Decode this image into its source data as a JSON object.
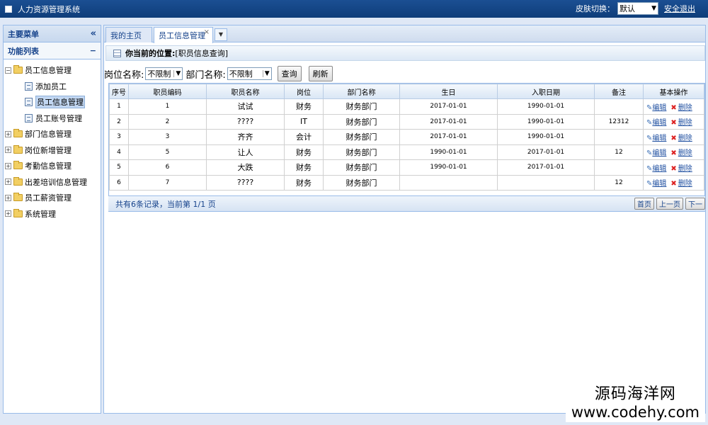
{
  "app": {
    "title": "人力资源管理系统",
    "skin_label": "皮肤切换：",
    "skin_value": "默认",
    "logout": "安全退出"
  },
  "sidebar": {
    "header": "主要菜单",
    "collapse": "«",
    "sub_header": "功能列表",
    "sub_ctl": "−",
    "items": [
      {
        "label": "员工信息管理",
        "expanded": true,
        "children": [
          "添加员工",
          "员工信息管理",
          "员工账号管理"
        ]
      },
      {
        "label": "部门信息管理"
      },
      {
        "label": "岗位新增管理"
      },
      {
        "label": "考勤信息管理"
      },
      {
        "label": "出差培训信息管理"
      },
      {
        "label": "员工薪资管理"
      },
      {
        "label": "系统管理"
      }
    ],
    "selected_child": "员工信息管理"
  },
  "tabs": [
    {
      "label": "我的主页",
      "active": false
    },
    {
      "label": "员工信息管理",
      "active": true,
      "close": "×"
    }
  ],
  "tab_menu": "▼",
  "location": {
    "label": "你当前的位置:",
    "value": "[职员信息查询]"
  },
  "search": {
    "position_label": "岗位名称:",
    "position_value": "不限制",
    "dept_label": "部门名称:",
    "dept_value": "不限制",
    "query_button": "查询",
    "refresh_button": "刷新"
  },
  "table": {
    "headers": [
      "序号",
      "职员编码",
      "职员名称",
      "岗位",
      "部门名称",
      "生日",
      "入职日期",
      "备注",
      "基本操作"
    ],
    "rows": [
      [
        "1",
        "1",
        "试试",
        "财务",
        "财务部门",
        "2017-01-01",
        "1990-01-01",
        ""
      ],
      [
        "2",
        "2",
        "????",
        "IT",
        "财务部门",
        "2017-01-01",
        "1990-01-01",
        "12312"
      ],
      [
        "3",
        "3",
        "齐齐",
        "会计",
        "财务部门",
        "2017-01-01",
        "1990-01-01",
        ""
      ],
      [
        "4",
        "5",
        "让人",
        "财务",
        "财务部门",
        "1990-01-01",
        "2017-01-01",
        "12"
      ],
      [
        "5",
        "6",
        "大跌",
        "财务",
        "财务部门",
        "1990-01-01",
        "2017-01-01",
        ""
      ],
      [
        "6",
        "7",
        "????",
        "财务",
        "财务部门",
        "",
        "",
        "12"
      ]
    ],
    "edit_label": "编辑",
    "delete_label": "删除"
  },
  "footer": {
    "summary": "共有6条记录，当前第 1/1 页",
    "first": "首页",
    "prev": "上一页",
    "next": "下一"
  },
  "watermark": {
    "cn": "源码海洋网",
    "url": "www.codehy.com"
  },
  "icons": [
    "app-icon",
    "collapse-icon",
    "folder-icon",
    "document-icon",
    "grid-icon",
    "pencil-icon",
    "delete-x-icon",
    "dropdown-arrow-icon"
  ]
}
